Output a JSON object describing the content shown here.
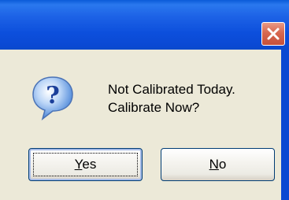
{
  "window": {
    "close_icon": "close-icon"
  },
  "dialog": {
    "icon": "question-icon",
    "message_line1": "Not Calibrated Today.",
    "message_line2": "Calibrate Now?"
  },
  "buttons": {
    "yes_mnemonic": "Y",
    "yes_rest": "es",
    "no_mnemonic": "N",
    "no_rest": "o"
  },
  "colors": {
    "titlebar": "#0a5ad8",
    "dialog_bg": "#ece9d8",
    "close_button": "#d8684f",
    "button_border": "#003c74"
  }
}
